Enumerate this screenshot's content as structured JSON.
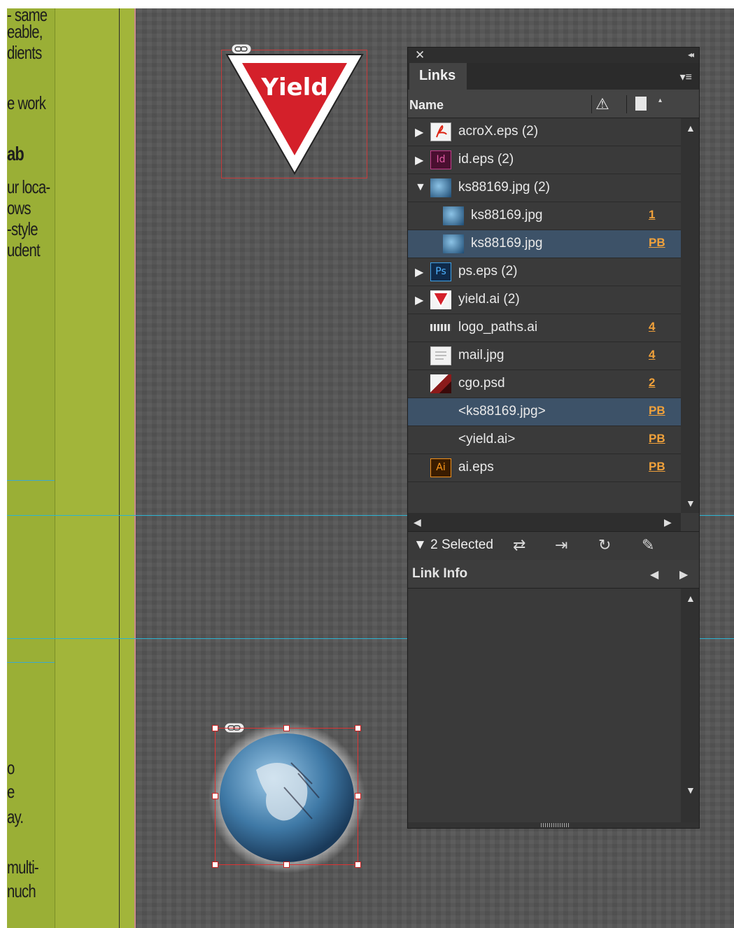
{
  "document": {
    "text_lines": [
      "- same",
      "eable,",
      "dients",
      "e work",
      "ab",
      "ur loca-",
      "ows",
      "-style",
      "udent",
      "o",
      "e",
      "ay.",
      "multi-",
      "nuch"
    ],
    "yield_sign_text": "Yield"
  },
  "panel": {
    "close_glyph": "✕",
    "collapse_glyph": "◂◂",
    "tab_label": "Links",
    "menu_glyph": "▾≡",
    "columns": {
      "name": "Name",
      "status_glyph": "⚠",
      "page_caret": "▴"
    },
    "rows": [
      {
        "label": "acroX.eps (2)",
        "page": "",
        "expand": "▶",
        "icon": "pdf-icon",
        "indent": 0
      },
      {
        "label": "id.eps (2)",
        "page": "",
        "expand": "▶",
        "icon": "indesign-icon",
        "icon_text": "Id",
        "indent": 0
      },
      {
        "label": "ks88169.jpg (2)",
        "page": "",
        "expand": "▼",
        "icon": "globe-thumbnail-icon",
        "indent": 0
      },
      {
        "label": "ks88169.jpg",
        "page": "1",
        "expand": "",
        "icon": "globe-thumbnail-icon",
        "indent": 1
      },
      {
        "label": "ks88169.jpg",
        "page": "PB",
        "expand": "",
        "icon": "globe-thumbnail-icon",
        "indent": 1,
        "selected": true
      },
      {
        "label": "ps.eps (2)",
        "page": "",
        "expand": "▶",
        "icon": "photoshop-icon",
        "icon_text": "Ps",
        "indent": 0
      },
      {
        "label": "yield.ai (2)",
        "page": "",
        "expand": "▶",
        "icon": "yield-thumbnail-icon",
        "indent": 0
      },
      {
        "label": "logo_paths.ai",
        "page": "4",
        "expand": "",
        "icon": "logo-thumbnail-icon",
        "indent": 0
      },
      {
        "label": "mail.jpg",
        "page": "4",
        "expand": "",
        "icon": "mail-thumbnail-icon",
        "indent": 0
      },
      {
        "label": "cgo.psd",
        "page": "2",
        "expand": "",
        "icon": "cgo-thumbnail-icon",
        "indent": 0
      },
      {
        "label": "<ks88169.jpg>",
        "page": "PB",
        "expand": "",
        "icon": "",
        "indent": 0,
        "selected": true
      },
      {
        "label": "<yield.ai>",
        "page": "PB",
        "expand": "",
        "icon": "",
        "indent": 0
      },
      {
        "label": "ai.eps",
        "page": "PB",
        "expand": "",
        "icon": "illustrator-icon",
        "icon_text": "Ai",
        "indent": 0
      }
    ],
    "selection_label": "2 Selected",
    "selection_caret": "▼",
    "tools": {
      "relink": "⇄",
      "goto": "⇥",
      "update": "↻",
      "edit": "✎"
    },
    "link_info_label": "Link Info",
    "colors": {
      "accent_orange": "#f0a13b",
      "selected_row": "#3d5268",
      "panel_bg": "#3a3a3a"
    }
  }
}
